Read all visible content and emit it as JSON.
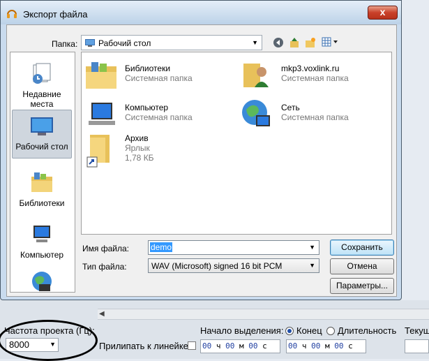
{
  "dialog": {
    "title": "Экспорт файла",
    "close_label": "x",
    "folder_label": "Папка:",
    "folder_value": "Рабочий стол",
    "toolbar_icons": [
      "back-icon",
      "up-folder-icon",
      "new-folder-icon",
      "views-menu-icon"
    ],
    "places": [
      {
        "label": "Недавние места",
        "icon": "recent-places-icon"
      },
      {
        "label": "Рабочий стол",
        "icon": "desktop-icon",
        "selected": true
      },
      {
        "label": "Библиотеки",
        "icon": "libraries-icon"
      },
      {
        "label": "Компьютер",
        "icon": "computer-icon"
      },
      {
        "label": "",
        "icon": "network-icon"
      }
    ],
    "files": [
      {
        "name": "Библиотеки",
        "type": "Системная папка",
        "icon": "libraries-folder-icon"
      },
      {
        "name": "mkp3.voxlink.ru",
        "type": "Системная папка",
        "icon": "user-folder-icon"
      },
      {
        "name": "Компьютер",
        "type": "Системная папка",
        "icon": "computer-icon"
      },
      {
        "name": "Сеть",
        "type": "Системная папка",
        "icon": "network-icon"
      },
      {
        "name": "Архив",
        "type": "Ярлык",
        "size": "1,78 КБ",
        "icon": "folder-shortcut-icon"
      }
    ],
    "filename_label": "Имя файла:",
    "filename_value": "demo",
    "filetype_label": "Тип файла:",
    "filetype_value": "WAV (Microsoft) signed 16 bit PCM",
    "save_button": "Сохранить",
    "cancel_button": "Отмена",
    "params_button": "Параметры..."
  },
  "bottom": {
    "project_rate_label": "Частота проекта (Гц):",
    "project_rate_value": "8000",
    "snap_label": "Прилипать к линейке",
    "selection_start_label": "Начало выделения:",
    "end_option": "Конец",
    "length_option": "Длительность",
    "current_label": "Текущ",
    "time_start": {
      "h": "00",
      "m": "00",
      "s": "00"
    },
    "time_end": {
      "h": "00",
      "m": "00",
      "s": "00"
    },
    "units": {
      "h": "ч",
      "m": "м",
      "s": "с"
    },
    "colors": {
      "digit": "#1f3ea0"
    }
  }
}
